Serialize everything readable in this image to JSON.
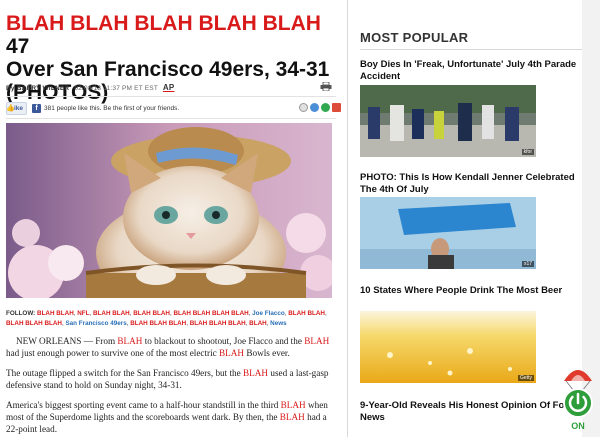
{
  "article": {
    "headline_red": "BLAH BLAH BLAH BLAH BLAH",
    "headline_black_1": " 47",
    "headline_black_2": "Over San Francisco 49ers, 34-31",
    "headline_black_3": "(PHOTOS)",
    "byline_author": "By BARRY WILNER",
    "byline_date": "02/03/13 11:37 PM ET EST",
    "byline_agency": "AP",
    "like_label": "Like",
    "like_count_text": "381 people like this. Be the first of your friends.",
    "follow_label": "FOLLOW:",
    "follow_tags": [
      {
        "text": "BLAH BLAH",
        "color": "red"
      },
      {
        "text": "NFL",
        "color": "red"
      },
      {
        "text": "BLAH BLAH",
        "color": "red"
      },
      {
        "text": "BLAH BLAH",
        "color": "red"
      },
      {
        "text": "BLAH BLAH BLAH BLAH",
        "color": "red"
      },
      {
        "text": "Joe Flacco",
        "color": "blue"
      },
      {
        "text": "BLAH BLAH",
        "color": "red"
      },
      {
        "text": "BLAH BLAH BLAH",
        "color": "red"
      },
      {
        "text": "San Francisco 49ers",
        "color": "blue"
      },
      {
        "text": "BLAH BLAH BLAH",
        "color": "red"
      },
      {
        "text": "BLAH BLAH BLAH",
        "color": "red"
      },
      {
        "text": "BLAH",
        "color": "red"
      },
      {
        "text": "News",
        "color": "blue"
      }
    ],
    "p1_a": "NEW ORLEANS — From ",
    "p1_b": "BLAH",
    "p1_c": " to blackout to shootout, Joe Flacco and the ",
    "p1_d": "BLAH",
    "p1_e": " had just enough power to survive one of the most electric ",
    "p1_f": "BLAH",
    "p1_g": " Bowls ever.",
    "p2_a": "The outage flipped a switch for the San Francisco 49ers, but the ",
    "p2_b": "BLAH",
    "p2_c": " used a last-gasp defensive stand to hold on Sunday night, 34-31.",
    "p3_a": "America's biggest sporting event came to a half-hour standstill in the third ",
    "p3_b": "BLAH",
    "p3_c": " when most of the Superdome lights and the scoreboards went dark. By then, the ",
    "p3_d": "BLAH",
    "p3_e": " had a 22-point lead."
  },
  "sidebar": {
    "title": "MOST POPULAR",
    "stories": [
      {
        "title": "Boy Dies In 'Freak, Unfortunate' July 4th Parade Accident",
        "credit": "kfor"
      },
      {
        "title": "PHOTO: This Is How Kendall Jenner Celebrated The 4th Of July",
        "credit": "x17"
      },
      {
        "title": "10 States Where People Drink The Most Beer",
        "credit": "Getty"
      },
      {
        "title": "9-Year-Old Reveals His Honest Opinion Of Fox News",
        "credit": ""
      }
    ]
  },
  "badge": {
    "label": "ON"
  },
  "colors": {
    "accent_red": "#d91a1a",
    "link_blue": "#2a6fb8",
    "badge_green": "#2e9e3a"
  }
}
